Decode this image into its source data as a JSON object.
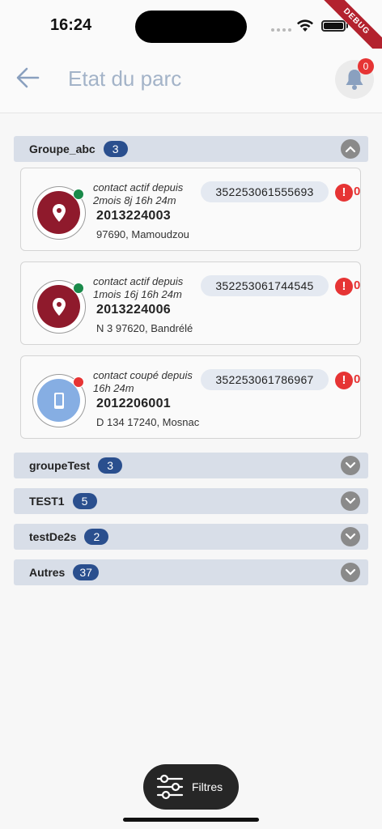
{
  "status_bar": {
    "time": "16:24"
  },
  "debug_label": "DEBUG",
  "header": {
    "title": "Etat du parc",
    "notification_count": "0"
  },
  "groups": [
    {
      "name": "Groupe_abc",
      "count": "3",
      "expanded": true
    },
    {
      "name": "groupeTest",
      "count": "3",
      "expanded": false
    },
    {
      "name": "TEST1",
      "count": "5",
      "expanded": false
    },
    {
      "name": "testDe2s",
      "count": "2",
      "expanded": false
    },
    {
      "name": "Autres",
      "count": "37",
      "expanded": false
    }
  ],
  "devices": [
    {
      "contact": "contact actif depuis 2mois 8j 16h 24m",
      "id": "2013224003",
      "address": "97690, Mamoudzou",
      "imei": "352253061555693",
      "alert_icon": "!",
      "alert_count": "0",
      "status": "active",
      "status_color": "#1a8a4a",
      "icon": "map-pin-icon"
    },
    {
      "contact": "contact actif depuis 1mois 16j 16h 24m",
      "id": "2013224006",
      "address": "N 3 97620, Bandrélé",
      "imei": "352253061744545",
      "alert_icon": "!",
      "alert_count": "0",
      "status": "active",
      "status_color": "#1a8a4a",
      "icon": "map-pin-icon"
    },
    {
      "contact": "contact coupé depuis 16h 24m",
      "id": "2012206001",
      "address": "D 134 17240, Mosnac",
      "imei": "352253061786967",
      "alert_icon": "!",
      "alert_count": "0",
      "status": "cut",
      "status_color": "#e63434",
      "icon": "phone-icon"
    }
  ],
  "footer": {
    "filters_label": "Filtres"
  },
  "colors": {
    "accent": "#2a4f8e",
    "alert": "#e63434",
    "active_device": "#8f1a2c",
    "cut_device": "#86aee3",
    "title": "#a3b3c8"
  }
}
